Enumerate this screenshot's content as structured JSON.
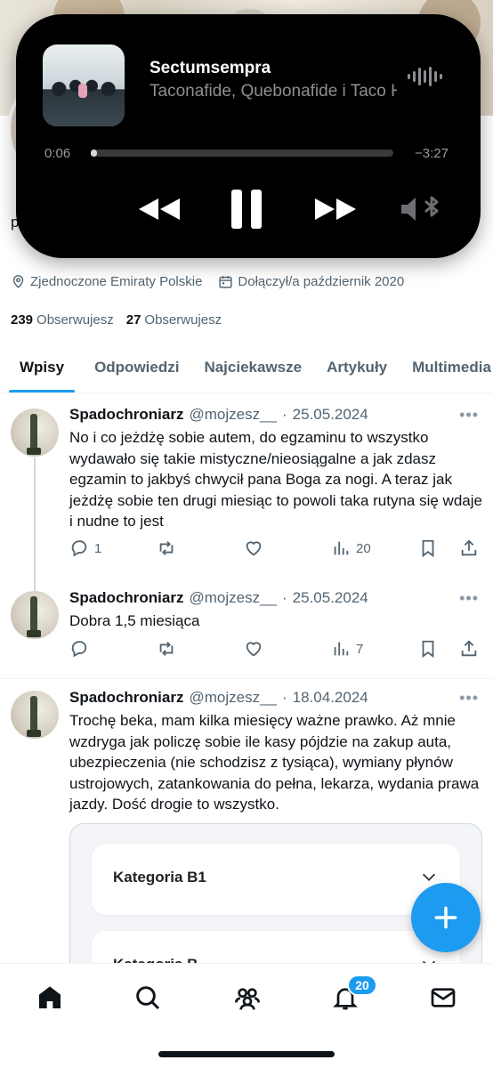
{
  "player": {
    "track_title": "Sectumsempra",
    "track_artist": "Taconafide, Quebonafide i Taco Hemingway",
    "time_current": "0:06",
    "time_remaining": "−3:27",
    "progress_fraction": 0.02
  },
  "profile": {
    "bio_peek": "produkcyjnego",
    "location": "Zjednoczone Emiraty Polskie",
    "joined": "Dołączył/a październik 2020",
    "following_count": "239",
    "following_label": "Obserwujesz",
    "followers_count": "27",
    "followers_label": "Obserwujesz"
  },
  "tabs": [
    {
      "label": "Wpisy",
      "active": true
    },
    {
      "label": "Odpowiedzi",
      "active": false
    },
    {
      "label": "Najciekawsze",
      "active": false
    },
    {
      "label": "Artykuły",
      "active": false
    },
    {
      "label": "Multimedia",
      "active": false
    }
  ],
  "posts": [
    {
      "name": "Spadochroniarz",
      "handle": "@mojzesz__",
      "separator": "·",
      "date": "25.05.2024",
      "text": "No i co jeżdżę sobie autem, do egzaminu to wszystko wydawało się takie mistyczne/nieosiągalne a jak zdasz egzamin to jakbyś chwycił pana Boga za nogi. A teraz jak jeżdżę sobie ten drugi miesiąc to powoli taka rutyna się wdaje i nudne to jest",
      "replies": "1",
      "views": "20"
    },
    {
      "name": "Spadochroniarz",
      "handle": "@mojzesz__",
      "separator": "·",
      "date": "25.05.2024",
      "text": "Dobra 1,5 miesiąca",
      "replies": "",
      "views": "7"
    },
    {
      "name": "Spadochroniarz",
      "handle": "@mojzesz__",
      "separator": "·",
      "date": "18.04.2024",
      "text": "Trochę beka, mam kilka miesięcy ważne prawko. Aż mnie wzdryga jak policzę sobie ile kasy pójdzie na zakup auta, ubezpieczenia (nie schodzisz z tysiąca), wymiany płynów ustrojowych, zatankowania do pełna, lekarza, wydania prawa jazdy. Dość drogie to wszystko.",
      "card_items": [
        "Kategoria B1",
        "Kategoria B"
      ]
    }
  ],
  "bottom_nav": {
    "notifications_badge": "20"
  },
  "colors": {
    "accent": "#1d9bf0",
    "text_primary": "#0f1419",
    "text_secondary": "#536471",
    "player_bg": "#000000"
  }
}
